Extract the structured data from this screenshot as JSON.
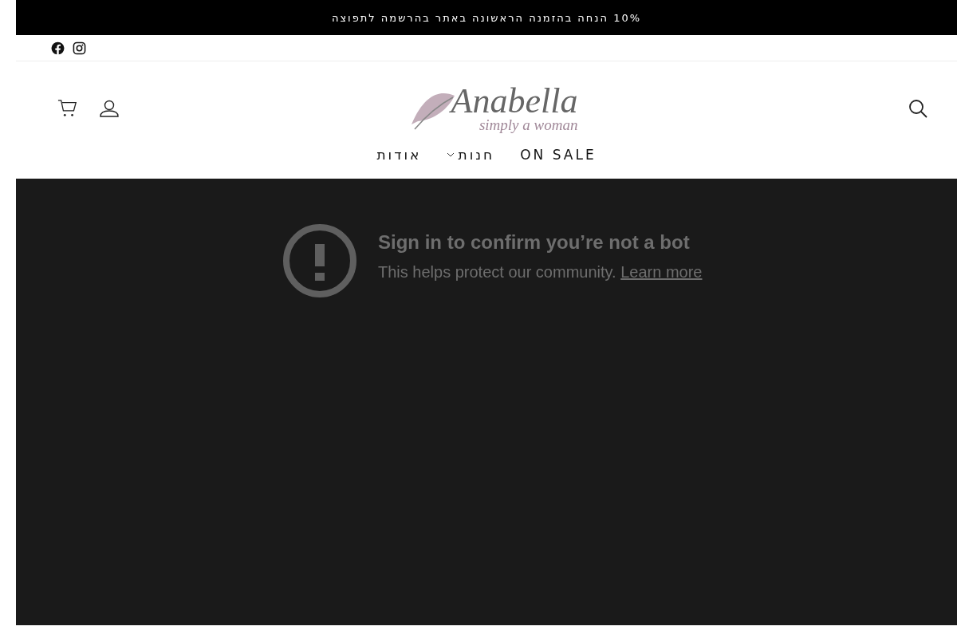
{
  "announcement": "10% הנחה בהזמנה הראשונה באתר בהרשמה לתפוצה",
  "logo": {
    "name": "Anabella",
    "tagline": "simply a woman"
  },
  "nav": [
    {
      "label": "ON SALE",
      "dropdown": false
    },
    {
      "label": "חנות",
      "dropdown": true
    },
    {
      "label": "אודות",
      "dropdown": false
    }
  ],
  "video_notice": {
    "title": "Sign in to confirm you’re not a bot",
    "text": "This helps protect our community.",
    "link": "Learn more"
  }
}
